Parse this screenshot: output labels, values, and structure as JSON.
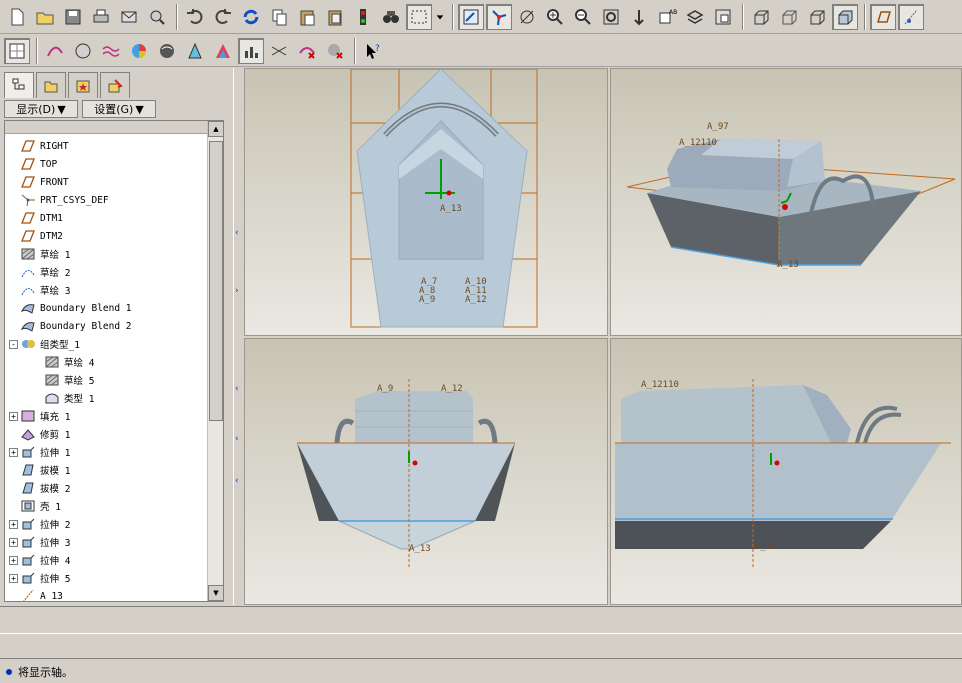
{
  "toolbar_row1": [
    "new-icon",
    "open-icon",
    "save-icon",
    "print-icon",
    "send-icon",
    "search-model-icon",
    "undo-icon",
    "redo-icon",
    "regenerate-icon",
    "copy-icon",
    "paste-icon",
    "paste-special-icon",
    "traffic-light-icon",
    "find-icon",
    "select-box-icon",
    "dropdown-icon",
    "repaint-icon",
    "spin-center-icon",
    "orient-icon",
    "zoom-in-icon",
    "zoom-out-icon",
    "refit-icon",
    "reorient-icon",
    "saved-view-icon",
    "layers-icon",
    "view-manager-icon",
    "wireframe-icon",
    "hidden-line-icon",
    "no-hidden-icon",
    "shading-icon",
    "datum-plane-icon",
    "datum-axis-icon"
  ],
  "toolbar_row2": [
    "sketch-grid-icon",
    "curvature-icon",
    "section-icon",
    "offset-icon",
    "draft-analysis-icon",
    "reflection-icon",
    "slope-icon",
    "shaded-curvature-icon",
    "saved-analysis-icon",
    "hide-all-icon",
    "delete-all-curvature-icon",
    "delete-all-sections-icon",
    "context-help-icon"
  ],
  "panel": {
    "tabs": [
      "model-tree-tab",
      "folder-tab",
      "favorites-tab",
      "connections-tab"
    ],
    "show_label": "显示(D)",
    "settings_label": "设置(G)"
  },
  "tree": [
    {
      "label": "RIGHT",
      "icon": "datum-plane-icon",
      "level": 0,
      "expand": ""
    },
    {
      "label": "TOP",
      "icon": "datum-plane-icon",
      "level": 0,
      "expand": ""
    },
    {
      "label": "FRONT",
      "icon": "datum-plane-icon",
      "level": 0,
      "expand": ""
    },
    {
      "label": "PRT_CSYS_DEF",
      "icon": "csys-icon",
      "level": 0,
      "expand": ""
    },
    {
      "label": "DTM1",
      "icon": "datum-plane-icon",
      "level": 0,
      "expand": ""
    },
    {
      "label": "DTM2",
      "icon": "datum-plane-icon",
      "level": 0,
      "expand": ""
    },
    {
      "label": "草绘 1",
      "icon": "sketch-icon",
      "level": 0,
      "expand": ""
    },
    {
      "label": "草绘 2",
      "icon": "sketch-curve-icon",
      "level": 0,
      "expand": ""
    },
    {
      "label": "草绘 3",
      "icon": "sketch-curve-icon",
      "level": 0,
      "expand": ""
    },
    {
      "label": "Boundary Blend 1",
      "icon": "boundary-blend-icon",
      "level": 0,
      "expand": ""
    },
    {
      "label": "Boundary Blend 2",
      "icon": "boundary-blend-icon",
      "level": 0,
      "expand": ""
    },
    {
      "label": "组类型_1",
      "icon": "group-icon",
      "level": 0,
      "expand": "-"
    },
    {
      "label": "草绘 4",
      "icon": "sketch-icon",
      "level": 1,
      "expand": ""
    },
    {
      "label": "草绘 5",
      "icon": "sketch-icon",
      "level": 1,
      "expand": ""
    },
    {
      "label": "类型 1",
      "icon": "pattern-icon",
      "level": 1,
      "expand": ""
    },
    {
      "label": "填充 1",
      "icon": "fill-icon",
      "level": 0,
      "expand": "+"
    },
    {
      "label": "修剪 1",
      "icon": "trim-icon",
      "level": 0,
      "expand": ""
    },
    {
      "label": "拉伸 1",
      "icon": "extrude-icon",
      "level": 0,
      "expand": "+"
    },
    {
      "label": "拔模 1",
      "icon": "draft-icon",
      "level": 0,
      "expand": ""
    },
    {
      "label": "拔模 2",
      "icon": "draft-icon",
      "level": 0,
      "expand": ""
    },
    {
      "label": "壳 1",
      "icon": "shell-icon",
      "level": 0,
      "expand": ""
    },
    {
      "label": "拉伸 2",
      "icon": "extrude-icon",
      "level": 0,
      "expand": "+"
    },
    {
      "label": "拉伸 3",
      "icon": "extrude-icon",
      "level": 0,
      "expand": "+"
    },
    {
      "label": "拉伸 4",
      "icon": "extrude-icon",
      "level": 0,
      "expand": "+"
    },
    {
      "label": "拉伸 5",
      "icon": "extrude-icon",
      "level": 0,
      "expand": "+"
    },
    {
      "label": "A_13",
      "icon": "datum-axis-icon",
      "level": 0,
      "expand": ""
    }
  ],
  "viewports": {
    "top_left": {
      "labels": [
        "A_13",
        "A_7",
        "A_8",
        "A_9",
        "A_10",
        "A_11",
        "A_12"
      ]
    },
    "top_right": {
      "labels": [
        "A_97",
        "A_12110",
        "A_13"
      ]
    },
    "bottom_left": {
      "labels": [
        "A_9",
        "A_12",
        "A_13"
      ]
    },
    "bottom_right": {
      "labels": [
        "A_12110",
        "A_13"
      ]
    }
  },
  "status": {
    "message": "将显示轴。"
  }
}
